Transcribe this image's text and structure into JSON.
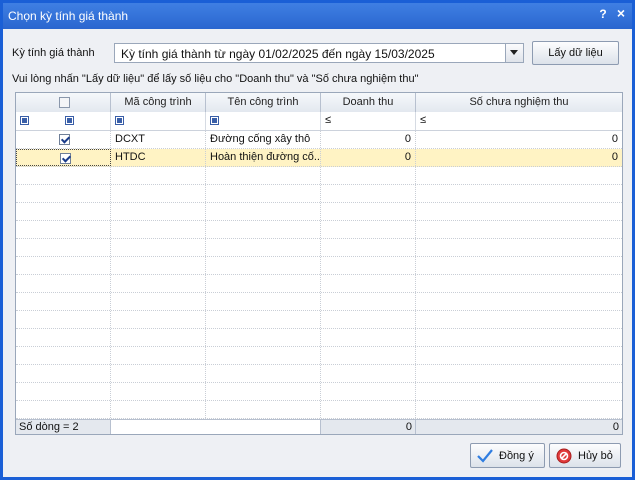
{
  "window": {
    "title": "Chọn kỳ tính giá thành",
    "help": "?",
    "close": "×"
  },
  "period": {
    "label": "Kỳ tính giá thành",
    "value": "Kỳ tính giá thành từ ngày 01/02/2025 đến ngày 15/03/2025"
  },
  "fetch_button": "Lấy dữ liệu",
  "hint": "Vui lòng nhấn \"Lấy dữ liệu\" để lấy số liệu cho \"Doanh thu\" và \"Số chưa nghiệm thu\"",
  "grid": {
    "headers": {
      "code": "Mã công trình",
      "name": "Tên công trình",
      "revenue": "Doanh thu",
      "unaccepted": "Số chưa nghiệm thu"
    },
    "filter_le": "≤",
    "rows": [
      {
        "checked": true,
        "code": "DCXT",
        "name": "Đường cống xây thô",
        "revenue": "0",
        "unaccepted": "0"
      },
      {
        "checked": true,
        "code": "HTDC",
        "name": "Hoàn thiện đường cố...",
        "revenue": "0",
        "unaccepted": "0"
      }
    ],
    "footer": {
      "count": "Số dòng = 2",
      "revenue_total": "0",
      "unaccepted_total": "0"
    }
  },
  "buttons": {
    "ok": "Đồng ý",
    "cancel": "Hủy bỏ"
  }
}
